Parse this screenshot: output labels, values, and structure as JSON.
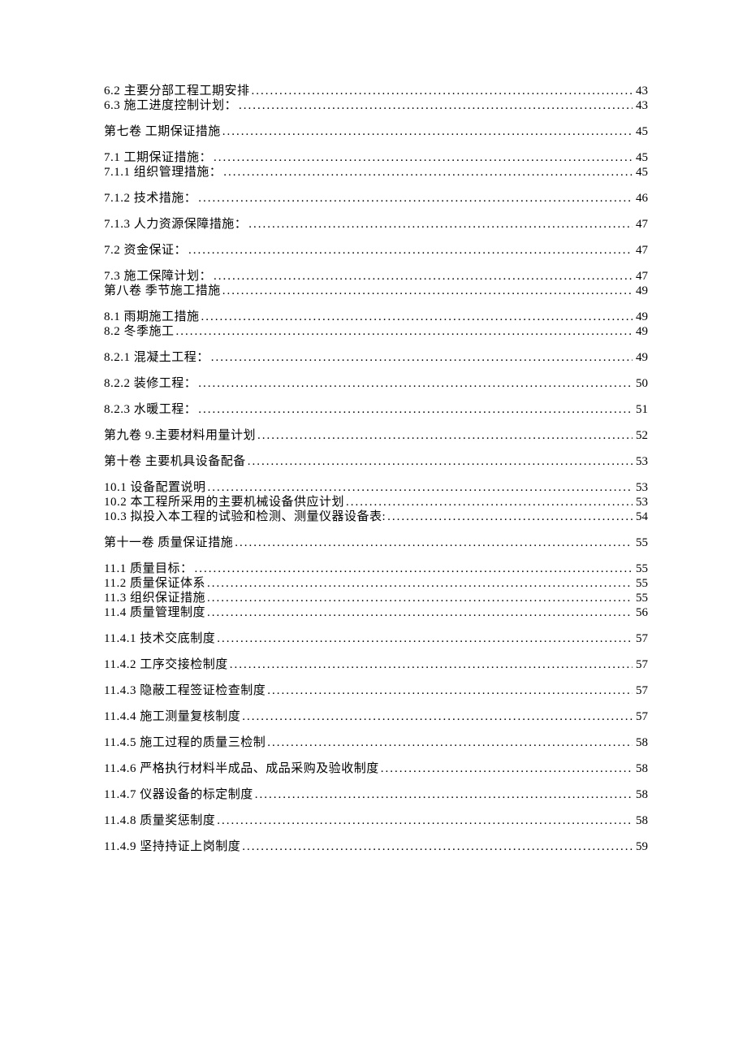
{
  "toc": [
    {
      "title": "6.2 主要分部工程工期安排",
      "page": "43",
      "spacing": "tight"
    },
    {
      "title": "6.3 施工进度控制计划：",
      "page": "43",
      "spacing": "loose"
    },
    {
      "title": "第七卷 工期保证措施",
      "page": "45",
      "spacing": "loose"
    },
    {
      "title": "7.1   工期保证措施：",
      "page": "45",
      "spacing": "tight"
    },
    {
      "title": "7.1.1 组织管理措施：",
      "page": "45",
      "spacing": "loose"
    },
    {
      "title": "7.1.2 技术措施：",
      "page": "46",
      "spacing": "loose"
    },
    {
      "title": "7.1.3 人力资源保障措施：",
      "page": "47",
      "spacing": "loose"
    },
    {
      "title": "7.2 资金保证：",
      "page": "47",
      "spacing": "loose"
    },
    {
      "title": "7.3 施工保障计划：",
      "page": "47",
      "spacing": "tight"
    },
    {
      "title": "第八卷 季节施工措施",
      "page": "49",
      "spacing": "loose"
    },
    {
      "title": "8.1 雨期施工措施",
      "page": "49",
      "spacing": "tight"
    },
    {
      "title": "8.2 冬季施工",
      "page": "49",
      "spacing": "loose"
    },
    {
      "title": "8.2.1 混凝土工程：",
      "page": "49",
      "spacing": "loose"
    },
    {
      "title": "8.2.2 装修工程：",
      "page": "50",
      "spacing": "loose"
    },
    {
      "title": "8.2.3 水暖工程：",
      "page": "51",
      "spacing": "loose"
    },
    {
      "title": "第九卷 9.主要材料用量计划",
      "page": "52",
      "spacing": "loose"
    },
    {
      "title": "第十卷 主要机具设备配备",
      "page": "53",
      "spacing": "loose"
    },
    {
      "title": "10.1 设备配置说明",
      "page": "53",
      "spacing": "tight"
    },
    {
      "title": "10.2 本工程所采用的主要机械设备供应计划",
      "page": "53",
      "spacing": "tight"
    },
    {
      "title": "10.3 拟投入本工程的试验和检测、测量仪器设备表:",
      "page": "54",
      "spacing": "loose"
    },
    {
      "title": "第十一卷 质量保证措施",
      "page": "55",
      "spacing": "loose"
    },
    {
      "title": "11.1 质量目标：",
      "page": "55",
      "spacing": "tight"
    },
    {
      "title": "11.2 质量保证体系",
      "page": "55",
      "spacing": "tight"
    },
    {
      "title": "11.3 组织保证措施",
      "page": "55",
      "spacing": "tight"
    },
    {
      "title": "11.4 质量管理制度",
      "page": "56",
      "spacing": "loose"
    },
    {
      "title": "11.4.1 技术交底制度",
      "page": "57",
      "spacing": "loose"
    },
    {
      "title": "11.4.2 工序交接检制度",
      "page": "57",
      "spacing": "loose"
    },
    {
      "title": "11.4.3 隐蔽工程签证检查制度",
      "page": "57",
      "spacing": "loose"
    },
    {
      "title": "11.4.4 施工测量复核制度",
      "page": "57",
      "spacing": "loose"
    },
    {
      "title": "11.4.5 施工过程的质量三检制",
      "page": "58",
      "spacing": "loose"
    },
    {
      "title": "11.4.6 严格执行材料半成品、成品采购及验收制度",
      "page": "58",
      "spacing": "loose"
    },
    {
      "title": "11.4.7 仪器设备的标定制度",
      "page": "58",
      "spacing": "loose"
    },
    {
      "title": "11.4.8 质量奖惩制度",
      "page": "58",
      "spacing": "loose"
    },
    {
      "title": "11.4.9 坚持持证上岗制度",
      "page": "59",
      "spacing": "loose"
    }
  ]
}
